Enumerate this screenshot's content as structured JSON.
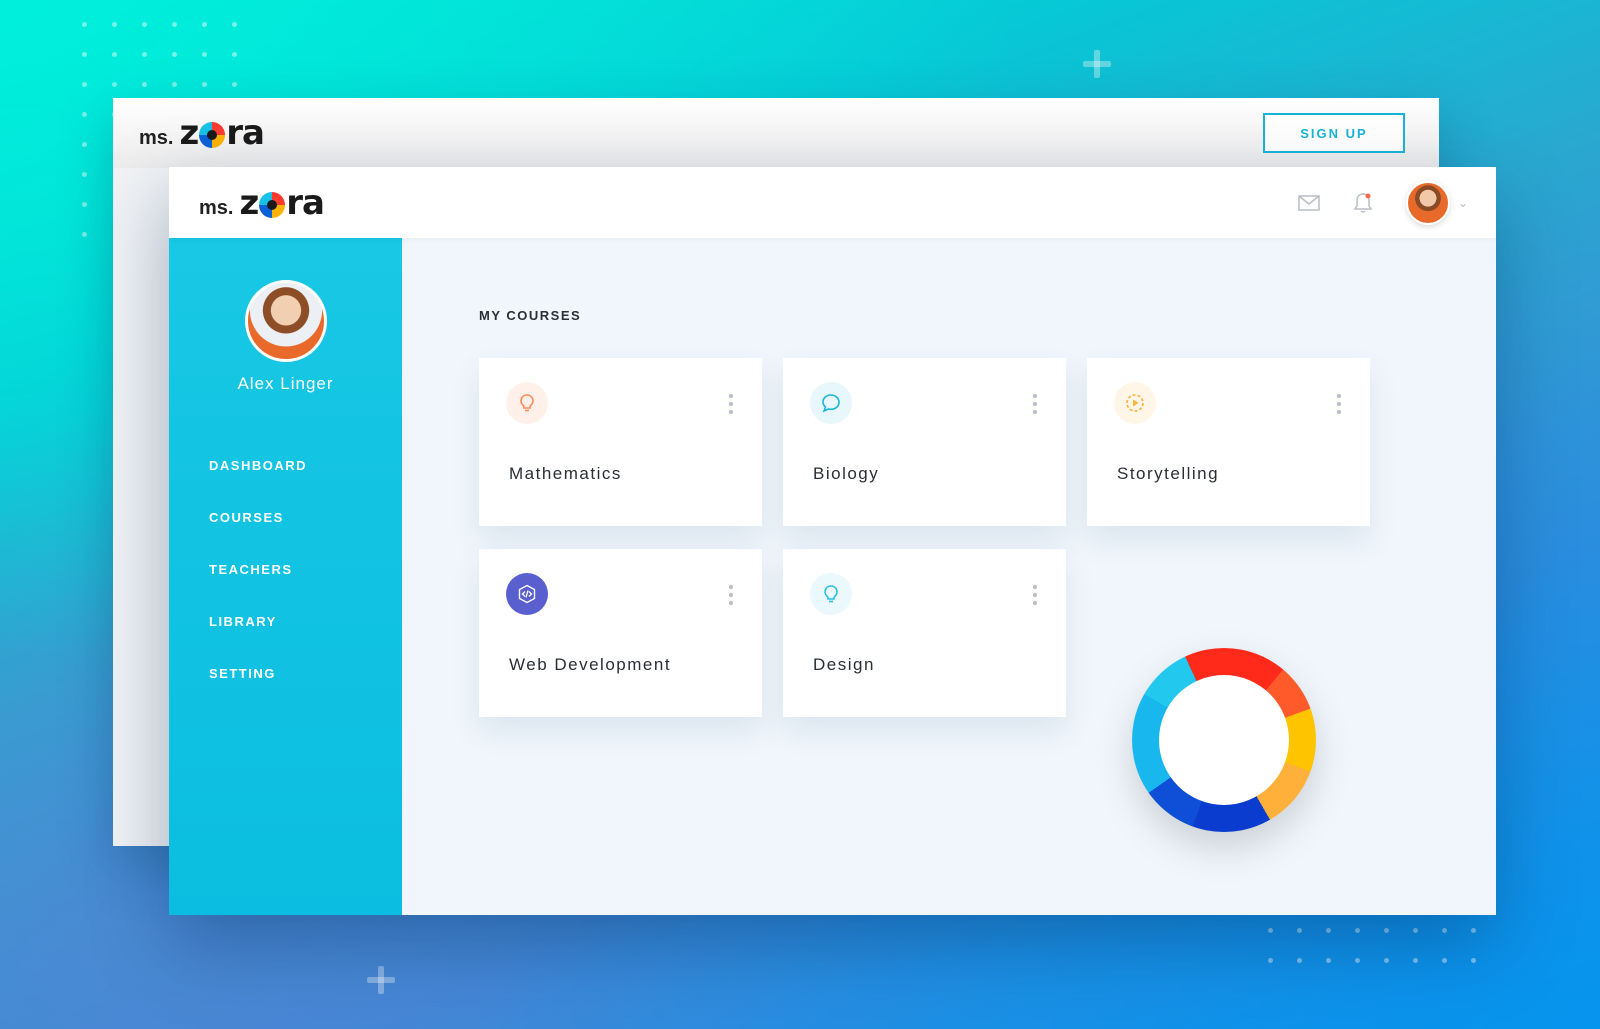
{
  "brand": {
    "prefix": "ms.",
    "name_start": "z",
    "name_end": "ra"
  },
  "back_window": {
    "signup_label": "SIGN UP"
  },
  "header": {
    "mail_icon": "mail-icon",
    "bell_icon": "bell-icon",
    "caret_icon": "chevron-down-icon"
  },
  "user": {
    "name": "Alex Linger"
  },
  "sidebar": {
    "items": [
      {
        "label": "DASHBOARD"
      },
      {
        "label": "COURSES"
      },
      {
        "label": "TEACHERS"
      },
      {
        "label": "LIBRARY"
      },
      {
        "label": "SETTING"
      }
    ]
  },
  "main": {
    "section_title": "MY COURSES",
    "courses": [
      {
        "title": "Mathematics",
        "icon": "lightbulb-icon",
        "icon_color": "#ff8a5c",
        "icon_bg": "#fff1ea"
      },
      {
        "title": "Biology",
        "icon": "chat-bubble-icon",
        "icon_color": "#19b8d8",
        "icon_bg": "#e8f7fb"
      },
      {
        "title": "Storytelling",
        "icon": "play-circle-icon",
        "icon_color": "#ffb23a",
        "icon_bg": "#fff6e8"
      },
      {
        "title": "Web Development",
        "icon": "code-icon",
        "icon_color": "#ffffff",
        "icon_bg": "#5a5fcf"
      },
      {
        "title": "Design",
        "icon": "lightbulb-icon",
        "icon_color": "#2ac0e4",
        "icon_bg": "#ebf8fc"
      }
    ]
  },
  "colors": {
    "accent": "#19b5d8",
    "sidebar": "#12c3e2",
    "donut": [
      "#ff2a1a",
      "#ffc400",
      "#0a3ccf",
      "#18b8ef"
    ]
  }
}
